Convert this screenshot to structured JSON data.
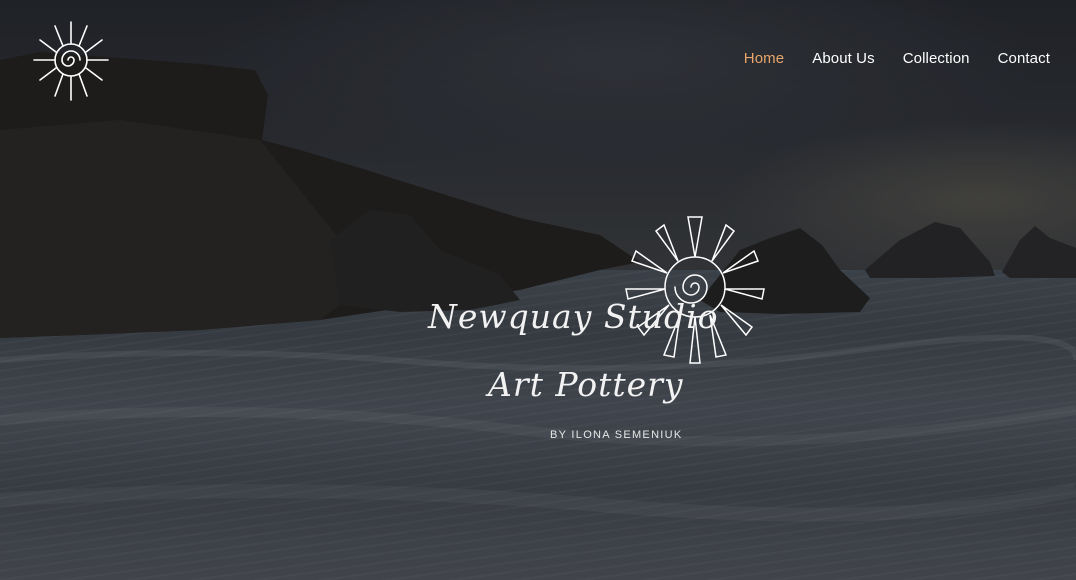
{
  "nav": {
    "items": [
      {
        "label": "Home",
        "active": true
      },
      {
        "label": "About Us",
        "active": false
      },
      {
        "label": "Collection",
        "active": false
      },
      {
        "label": "Contact",
        "active": false
      }
    ]
  },
  "brand": {
    "title_line1": "Newquay Studio",
    "title_line2": "Art Pottery",
    "byline": "BY ILONA SEMENIUK",
    "logo_icon": "sun-shell-icon"
  },
  "colors": {
    "active_nav": "#e8a66a",
    "nav_text": "#ffffff",
    "logo_stroke": "#ffffff"
  }
}
